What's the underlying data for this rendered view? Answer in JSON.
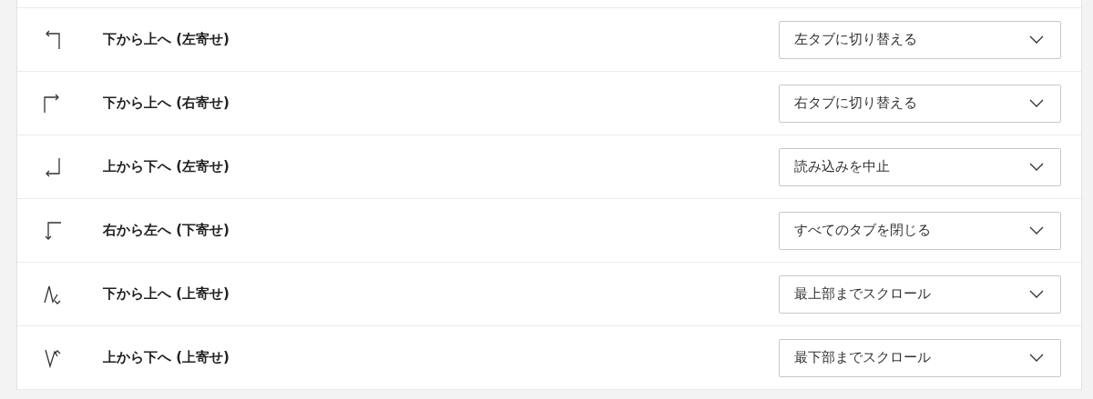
{
  "gestures": [
    {
      "kind": "up-left",
      "label": "下から上へ (左寄せ)",
      "action": "左タブに切り替える"
    },
    {
      "kind": "up-right",
      "label": "下から上へ (右寄せ)",
      "action": "右タブに切り替える"
    },
    {
      "kind": "down-left",
      "label": "上から下へ (左寄せ)",
      "action": "読み込みを中止"
    },
    {
      "kind": "left-down",
      "label": "右から左へ (下寄せ)",
      "action": "すべてのタブを閉じる"
    },
    {
      "kind": "up-zigzag",
      "label": "下から上へ (上寄せ)",
      "action": "最上部までスクロール"
    },
    {
      "kind": "down-zigzag",
      "label": "上から下へ (上寄せ)",
      "action": "最下部までスクロール"
    }
  ]
}
